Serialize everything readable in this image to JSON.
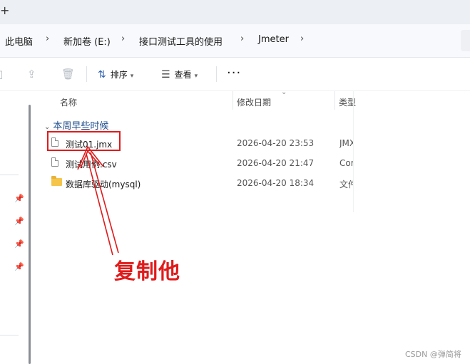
{
  "tabstrip": {
    "new_tab_glyph": "+"
  },
  "breadcrumb": {
    "items": [
      "此电脑",
      "新加卷 (E:)",
      "接口测试工具的使用",
      "Jmeter"
    ],
    "separator": "›"
  },
  "toolbar": {
    "sort_label": "排序",
    "view_label": "查看",
    "more_label": "···"
  },
  "columns": {
    "name": "名称",
    "date": "修改日期",
    "type": "类型"
  },
  "group": {
    "label": "本周早些时候"
  },
  "files": [
    {
      "name": "测试01.jmx",
      "date": "2026-04-20 23:53",
      "type": "JMX",
      "icon": "file-icon"
    },
    {
      "name": "测试用例.csv",
      "date": "2026-04-20 21:47",
      "type": "Com",
      "icon": "file-icon"
    },
    {
      "name": "数据库驱动(mysql)",
      "date": "2026-04-20 18:34",
      "type": "文件",
      "icon": "folder-icon"
    }
  ],
  "annotation": {
    "text": "复制他",
    "color": "#e01b1b"
  },
  "watermark": "CSDN @弹简将",
  "colors": {
    "accent": "#2b5fb3",
    "group_text": "#1f4e8c",
    "annotation_red": "#e01b1b"
  }
}
